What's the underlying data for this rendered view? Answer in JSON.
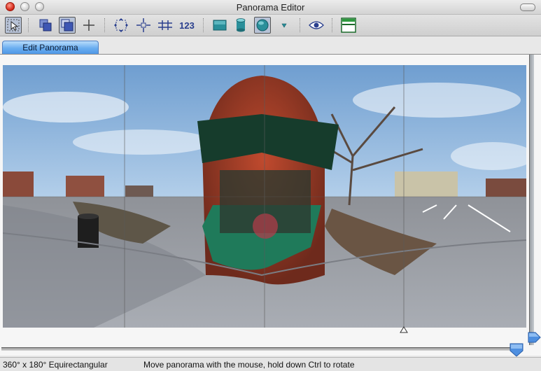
{
  "window": {
    "title": "Panorama Editor"
  },
  "toolbar": {
    "tools": [
      {
        "name": "selection-arrow-icon"
      },
      {
        "name": "bring-forward-icon"
      },
      {
        "name": "layers-icon"
      },
      {
        "name": "crosshair-icon"
      },
      {
        "name": "expand-arrows-icon"
      },
      {
        "name": "center-point-icon"
      },
      {
        "name": "horizontal-compress-icon"
      },
      {
        "name": "numbers-label",
        "label": "123"
      },
      {
        "name": "flat-projection-icon"
      },
      {
        "name": "cylinder-projection-icon"
      },
      {
        "name": "sphere-projection-icon"
      },
      {
        "name": "dropdown-triangle-icon"
      },
      {
        "name": "preview-eye-icon"
      },
      {
        "name": "window-layout-icon"
      }
    ]
  },
  "tabs": [
    {
      "label": "Edit Panorama",
      "active": true
    }
  ],
  "statusbar": {
    "projection": "360° x 180° Equirectangular",
    "hint": "Move panorama with the mouse, hold down Ctrl to rotate"
  },
  "colors": {
    "tab_active": "#6aaef0",
    "toolbar_icon": "#2a3f8e",
    "sky": "#9ec3e6",
    "awning_green": "#1f7a5a"
  }
}
